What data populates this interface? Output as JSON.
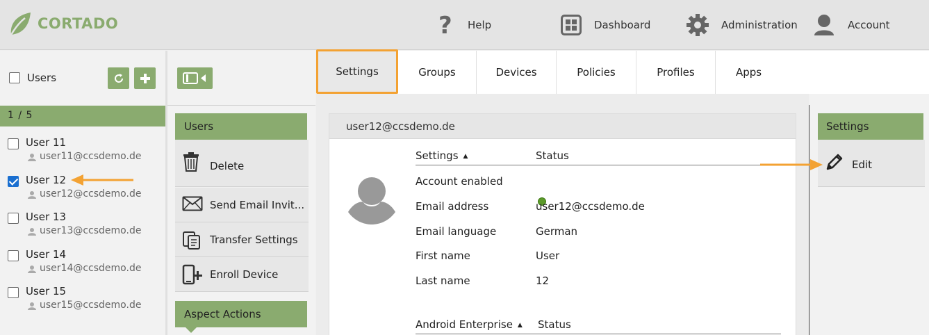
{
  "brand": {
    "name": "CORTADO",
    "accent": "#8aab6f",
    "highlight": "#f3a233"
  },
  "topnav": [
    {
      "label": "Help",
      "icon": "question-icon"
    },
    {
      "label": "Dashboard",
      "icon": "dashboard-icon"
    },
    {
      "label": "Administration",
      "icon": "gear-icon"
    },
    {
      "label": "Account",
      "icon": "user-icon"
    }
  ],
  "userlist": {
    "title": "Users",
    "pager": "1 / 5",
    "users": [
      {
        "name": "User 11",
        "email": "user11@ccsdemo.de",
        "checked": false
      },
      {
        "name": "User 12",
        "email": "user12@ccsdemo.de",
        "checked": true
      },
      {
        "name": "User 13",
        "email": "user13@ccsdemo.de",
        "checked": false
      },
      {
        "name": "User 14",
        "email": "user14@ccsdemo.de",
        "checked": false
      },
      {
        "name": "User 15",
        "email": "user15@ccsdemo.de",
        "checked": false
      }
    ]
  },
  "actions": {
    "users_title": "Users",
    "items": [
      {
        "label": "Delete",
        "icon": "trash-icon"
      },
      {
        "label": "Send Email Invit...",
        "icon": "envelope-icon"
      },
      {
        "label": "Transfer Settings",
        "icon": "copy-icon"
      },
      {
        "label": "Enroll Device",
        "icon": "add-device-icon"
      }
    ],
    "aspect_title": "Aspect Actions"
  },
  "tabs": [
    "Settings",
    "Groups",
    "Devices",
    "Policies",
    "Profiles",
    "Apps"
  ],
  "active_tab": "Settings",
  "detail": {
    "header": "user12@ccsdemo.de",
    "col_settings": "Settings",
    "col_status": "Status",
    "rows": [
      {
        "label": "Account enabled",
        "value": ""
      },
      {
        "label": "Email address",
        "value": "user12@ccsdemo.de"
      },
      {
        "label": "Email language",
        "value": "German"
      },
      {
        "label": "First name",
        "value": "User"
      },
      {
        "label": "Last name",
        "value": "12"
      }
    ],
    "col_android": "Android Enterprise",
    "col_status2": "Status",
    "enabled_color": "#5c9a2a"
  },
  "rightpanel": {
    "title": "Settings",
    "edit_label": "Edit"
  }
}
